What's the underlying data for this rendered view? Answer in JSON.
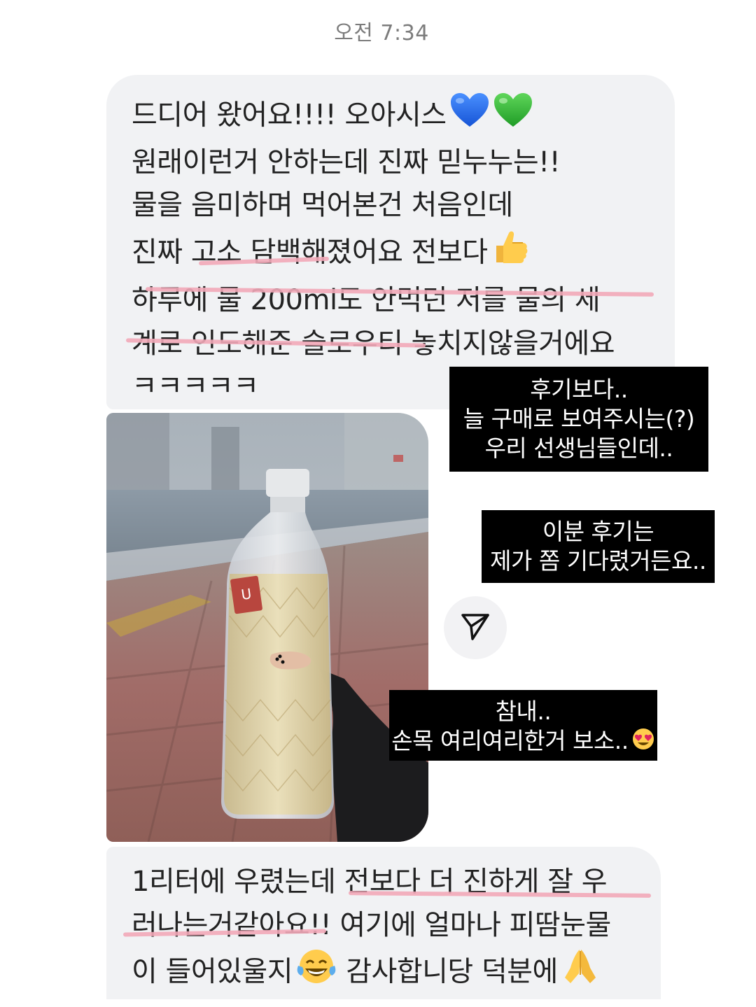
{
  "chat": {
    "timestamp": "오전 7:34",
    "message1": {
      "lines": [
        "드디어 왔어요!!!! 오아시스",
        "원래이런거 안하는데 진짜 믿누누는!!",
        "물을 음미하며 먹어본건 처음인데",
        "진짜 고소 담백해졌어요 전보다",
        "하루에 물 200ml도 안먹던 저를 물의 세",
        "계로 인도해준 슬로우티 놓치지않을거에요",
        "ㅋㅋㅋㅋㅋ"
      ],
      "emoji_line1": [
        "blue-heart-icon",
        "green-heart-icon"
      ],
      "emoji_line4": "thumbs-up-icon"
    },
    "photo": {
      "icon": "water-bottle-photo",
      "tag_label": "U"
    },
    "message2": {
      "lines": [
        "1리터에 우렸는데 전보다 더 진하게 잘 우",
        "러나는거같아요!! 여기에 얼마나 피땀눈물",
        "이 들어있울지 감사합니당 덕분에"
      ],
      "line3_part1": "이 들어있울지",
      "line3_part2": " 감사합니당 덕분에",
      "emoji_line3": [
        "laughing-tears-icon",
        "folded-hands-icon"
      ]
    }
  },
  "captions": {
    "c1": [
      "후기보다..",
      "늘 구매로 보여주시는(?)",
      "우리 선생님들인데.."
    ],
    "c2": [
      "이분 후기는",
      "제가 쫌 기다렸거든요.."
    ],
    "c3": [
      "참내..",
      "손목 여리여리한거 보소.."
    ]
  },
  "colors": {
    "bubble": "#f1f2f4",
    "underline": "#f2a8b8",
    "caption_bg": "#000000",
    "caption_text": "#ffffff"
  },
  "icons": {
    "share": "send-arrow-icon"
  }
}
